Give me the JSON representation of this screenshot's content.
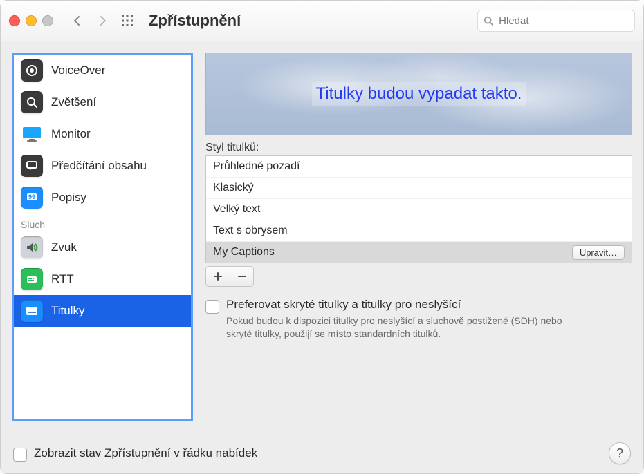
{
  "window": {
    "title": "Zpřístupnění",
    "search_placeholder": "Hledat"
  },
  "sidebar": {
    "group_label": "Sluch",
    "items": [
      {
        "label": "VoiceOver"
      },
      {
        "label": "Zvětšení"
      },
      {
        "label": "Monitor"
      },
      {
        "label": "Předčítání obsahu"
      },
      {
        "label": "Popisy"
      }
    ],
    "hearing_items": [
      {
        "label": "Zvuk"
      },
      {
        "label": "RTT"
      },
      {
        "label": "Titulky"
      }
    ],
    "selected_label": "Titulky"
  },
  "captions": {
    "preview_text": "Titulky budou vypadat takto.",
    "style_label": "Styl titulků:",
    "styles": [
      {
        "name": "Průhledné pozadí"
      },
      {
        "name": "Klasický"
      },
      {
        "name": "Velký text"
      },
      {
        "name": "Text s obrysem"
      },
      {
        "name": "My Captions",
        "selected": true,
        "editable": true
      }
    ],
    "edit_button": "Upravit…",
    "add_label": "+",
    "remove_label": "−",
    "prefer_sdh_label": "Preferovat skryté titulky a titulky pro neslyšící",
    "prefer_sdh_desc": "Pokud budou k dispozici titulky pro neslyšící a sluchově postižené (SDH) nebo skryté titulky, použijí se místo standardních titulků."
  },
  "footer": {
    "checkbox_label": "Zobrazit stav Zpřístupnění v řádku nabídek",
    "help_label": "?"
  }
}
